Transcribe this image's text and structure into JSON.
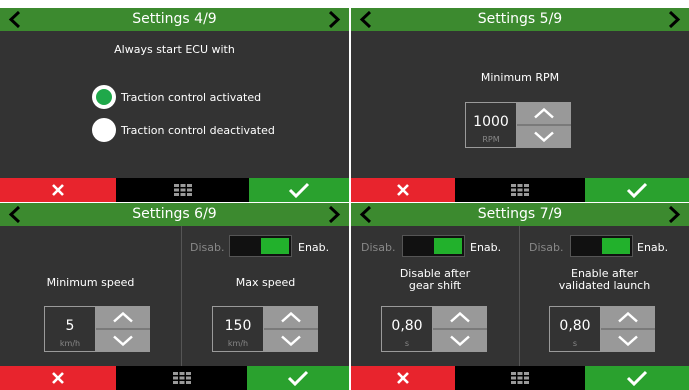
{
  "icons": {
    "prev": "chevron-left-icon",
    "next": "chevron-right-icon",
    "cancel": "x-icon",
    "menu": "grid-icon",
    "confirm": "check-icon",
    "increment": "chevron-up-icon",
    "decrement": "chevron-down-icon"
  },
  "colors": {
    "header": "#3c8a2f",
    "background": "#333333",
    "cancel": "#e8242d",
    "confirm": "#2aa12e",
    "radio_selected": "#1fa84a",
    "toggle_on": "#22b12c",
    "stepper": "#999999"
  },
  "screens": [
    {
      "title": "Settings 4/9",
      "prompt": "Always start ECU with",
      "options": [
        {
          "label": "Traction control activated",
          "selected": true
        },
        {
          "label": "Traction control deactivated",
          "selected": false
        }
      ]
    },
    {
      "title": "Settings 5/9",
      "field_label": "Minimum RPM",
      "value": "1000",
      "unit": "RPM"
    },
    {
      "title": "Settings 6/9",
      "left": {
        "label": "Minimum speed",
        "value": "5",
        "unit": "km/h"
      },
      "right": {
        "toggle_off_label": "Disab.",
        "toggle_on_label": "Enab.",
        "toggle_state": "enabled",
        "label": "Max speed",
        "value": "150",
        "unit": "km/h"
      }
    },
    {
      "title": "Settings 7/9",
      "left": {
        "toggle_off_label": "Disab.",
        "toggle_on_label": "Enab.",
        "toggle_state": "enabled",
        "label_line1": "Disable after",
        "label_line2": "gear shift",
        "value": "0,80",
        "unit": "s"
      },
      "right": {
        "toggle_off_label": "Disab.",
        "toggle_on_label": "Enab.",
        "toggle_state": "enabled",
        "label_line1": "Enable after",
        "label_line2": "validated launch",
        "value": "0,80",
        "unit": "s"
      }
    }
  ]
}
